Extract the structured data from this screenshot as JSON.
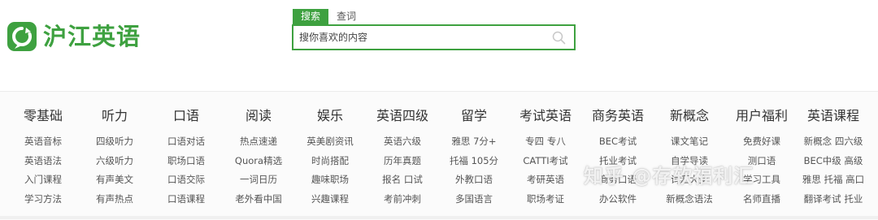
{
  "logo": {
    "text": "沪江英语",
    "icon": "hujiang-logo-icon"
  },
  "search": {
    "tabs": [
      {
        "label": "搜索",
        "active": true
      },
      {
        "label": "查词",
        "active": false
      }
    ],
    "placeholder": "搜你喜欢的内容",
    "icon": "search-icon"
  },
  "colors": {
    "brand": "#3ea140",
    "text": "#333333",
    "sub_text": "#555555"
  },
  "nav": {
    "columns": [
      {
        "title": "零基础",
        "items": [
          "英语音标",
          "英语语法",
          "入门课程",
          "学习方法"
        ]
      },
      {
        "title": "听力",
        "items": [
          "四级听力",
          "六级听力",
          "有声美文",
          "有声热点"
        ]
      },
      {
        "title": "口语",
        "items": [
          "口语对话",
          "职场口语",
          "口语交际",
          "口语课程"
        ]
      },
      {
        "title": "阅读",
        "items": [
          "热点速递",
          "Quora精选",
          "一词日历",
          "老外看中国"
        ]
      },
      {
        "title": "娱乐",
        "items": [
          "英美剧资讯",
          "时尚搭配",
          "趣味职场",
          "兴趣课程"
        ]
      },
      {
        "title": "英语四级",
        "items": [
          "英语六级",
          "历年真题",
          "报名 口试",
          "考前冲刺"
        ]
      },
      {
        "title": "留学",
        "items": [
          "雅思 7分+",
          "托福 105分",
          "外教口语",
          "多国语言"
        ]
      },
      {
        "title": "考试英语",
        "items": [
          "专四 专八",
          "CATTI考试",
          "考研英语",
          "职场考证"
        ]
      },
      {
        "title": "商务英语",
        "items": [
          "BEC考试",
          "托业考试",
          "商务口语",
          "办公软件"
        ]
      },
      {
        "title": "新概念",
        "items": [
          "课文笔记",
          "自学导读",
          "词汇大全",
          "新概念语法"
        ]
      },
      {
        "title": "用户福利",
        "items": [
          "免费好课",
          "测口语",
          "学习工具",
          "名师直播"
        ]
      },
      {
        "title": "英语课程",
        "items": [
          "新概念 四六级",
          "BEC中级 高级",
          "雅思 托福 高口",
          "翻译考试 托业"
        ]
      }
    ]
  },
  "watermark": "知乎 @存软福利汇"
}
